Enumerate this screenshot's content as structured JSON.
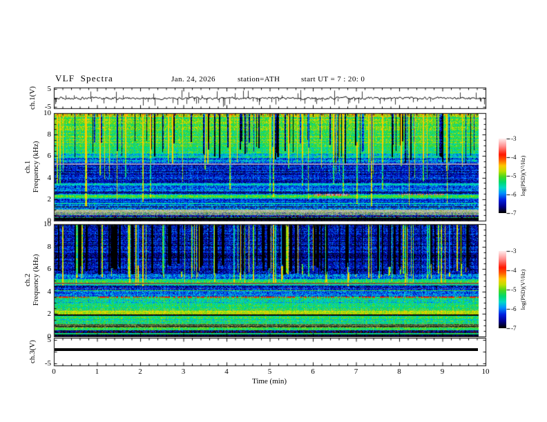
{
  "chart_data": {
    "type": "heatmap",
    "header": {
      "title": "VLF Spectra",
      "date": "Jan. 24, 2026",
      "station": "station=ATH",
      "start_ut": "start UT =  7 : 20: 0"
    },
    "time_axis": {
      "label": "Time (min)",
      "range": [
        0,
        10
      ],
      "tick_labels": [
        "0",
        "1",
        "2",
        "3",
        "4",
        "5",
        "6",
        "7",
        "8",
        "9",
        "10"
      ],
      "minor_per_major": 4,
      "data_end_min": 9.85
    },
    "colorbar": {
      "label": "log(PSD)(V²/Hz)",
      "tick_labels": [
        "-3",
        "-4",
        "-5",
        "-6",
        "-7"
      ],
      "value_range": [
        -7,
        -3
      ],
      "palette_stops": [
        [
          -7,
          "#000000"
        ],
        [
          -6.65,
          "#000090"
        ],
        [
          -6.3,
          "#0020e0"
        ],
        [
          -5.95,
          "#0090ff"
        ],
        [
          -5.65,
          "#00d8c8"
        ],
        [
          -5.35,
          "#00d870"
        ],
        [
          -5.05,
          "#48d820"
        ],
        [
          -4.75,
          "#c0e000"
        ],
        [
          -4.45,
          "#ffc800"
        ],
        [
          -4.15,
          "#ff6000"
        ],
        [
          -3.85,
          "#ff1800"
        ],
        [
          -3.4,
          "#ff9090"
        ],
        [
          -3.0,
          "#ffeaea"
        ]
      ]
    },
    "panels": [
      {
        "id": "ch1-waveform",
        "ylabel": "ch.1(V)",
        "yrange": [
          -5,
          5
        ],
        "ytick_labels": [
          "5",
          "-5"
        ],
        "signal": {
          "type": "noisy-line",
          "baseline": 0,
          "noise_amp": 0.7,
          "spike_count": 68,
          "spike_down_fraction": 0.6,
          "spike_amp_max": 5,
          "seed": 424242
        }
      },
      {
        "id": "ch1-spectrogram",
        "ylabel_lines": [
          "ch.1",
          "Frequency (kHz)"
        ],
        "yrange": [
          0,
          10
        ],
        "ytick_labels": [
          "10",
          "8",
          "6",
          "4",
          "2",
          "0"
        ],
        "seed": 12345,
        "bands": [
          {
            "f": [
              0,
              0.25
            ],
            "mean": -7,
            "spread": 0.15
          },
          {
            "f": [
              0.25,
              0.5
            ],
            "mean": -6.55,
            "spread": 0.5
          },
          {
            "f": [
              0.5,
              0.8
            ],
            "colors": [
              "#8a9478",
              "#b0b89c",
              "#98a880",
              "#6a7a5c",
              "#30c050",
              "#2a44aa",
              "#98a880"
            ]
          },
          {
            "f": [
              0.8,
              1.05
            ],
            "colors": [
              "#b4bcae",
              "#a2ac92",
              "#c2c8b8",
              "#8e9c7e",
              "#a8b840",
              "#b4bcae"
            ]
          },
          {
            "f": [
              1.05,
              1.55
            ],
            "mean": -6.1,
            "spread": 0.45
          },
          {
            "f": [
              1.55,
              1.7
            ],
            "mean": -5.6,
            "spread": 0.4
          },
          {
            "f": [
              1.7,
              2.05
            ],
            "mean": -6.2,
            "spread": 0.4
          },
          {
            "f": [
              2.05,
              2.45
            ],
            "mean": -5.25,
            "spread": 0.35
          },
          {
            "f": [
              2.45,
              2.8
            ],
            "mean": -6.3,
            "spread": 0.4
          },
          {
            "f": [
              2.8,
              3.3
            ],
            "mean": -6.1,
            "spread": 0.45
          },
          {
            "f": [
              3.3,
              3.5
            ],
            "mean": -5.5,
            "spread": 0.35
          },
          {
            "f": [
              3.5,
              5.2
            ],
            "mean": -6.45,
            "spread": 0.4
          },
          {
            "f": [
              5.2,
              5.35
            ],
            "colors": [
              "#9a93b8",
              "#b0a8c8",
              "#8888a8"
            ]
          },
          {
            "f": [
              5.35,
              5.9
            ],
            "mean": -6.05,
            "spread": 0.5
          },
          {
            "f": [
              5.9,
              6.3
            ],
            "mean": -5.6,
            "spread": 0.45
          },
          {
            "f": [
              6.3,
              7.2
            ],
            "mean": -5.3,
            "spread": 0.38
          },
          {
            "f": [
              7.2,
              9.7
            ],
            "mean": -5.12,
            "spread": 0.42
          },
          {
            "f": [
              9.7,
              10
            ],
            "mean": -4.8,
            "spread": 0.55
          }
        ],
        "lines": [
          {
            "f": 0.3,
            "color": "#28b048",
            "p": 0.7,
            "px": 1
          },
          {
            "f": 0.42,
            "color": "#8a2818",
            "p": 0.45,
            "px": 1
          },
          {
            "f": 1.32,
            "color": "#102060",
            "p": 0.8,
            "px": 2
          },
          {
            "f": 2.62,
            "color": "#0a1850",
            "p": 0.75,
            "px": 2
          },
          {
            "f": 3.9,
            "color": "#0a1440",
            "p": 0.6,
            "px": 1
          },
          {
            "f": 4.55,
            "color": "#0a1440",
            "p": 0.6,
            "px": 1
          },
          {
            "f": 2.42,
            "color": "#c0a0a0",
            "p": 0.85,
            "px": 3,
            "x": [
              6.1,
              6.95
            ],
            "dots": "#d04020"
          },
          {
            "f": 2.42,
            "color": "#b89890",
            "p": 0.7,
            "px": 2,
            "x": [
              8.1,
              9.2
            ],
            "dots": "#c05020"
          },
          {
            "f": 9.93,
            "color": "#d03010",
            "p": 0.22,
            "px": 1
          }
        ],
        "streaks": {
          "bright": {
            "count": 48,
            "delta": [
              0.8,
              1.7
            ],
            "f_lo": [
              1.3,
              5.5
            ],
            "f_hi": 10,
            "width": [
              1,
              2
            ]
          },
          "dark": {
            "count": 72,
            "delta": [
              -2.2,
              -1.0
            ],
            "f_lo": [
              5.3,
              7.6
            ],
            "f_hi": 10,
            "width": [
              1,
              2
            ]
          }
        }
      },
      {
        "id": "ch2-spectrogram",
        "ylabel_lines": [
          "ch.2",
          "Frequency (kHz)"
        ],
        "yrange": [
          0,
          10
        ],
        "ytick_labels": [
          "10",
          "8",
          "6",
          "4",
          "2",
          "0"
        ],
        "seed": 98765,
        "bands": [
          {
            "f": [
              0,
              0.2
            ],
            "mean": -7,
            "spread": 0.1
          },
          {
            "f": [
              0.2,
              0.33
            ],
            "mean": -5.2,
            "spread": 0.4
          },
          {
            "f": [
              0.33,
              0.55
            ],
            "mean": -6.75,
            "spread": 0.5
          },
          {
            "f": [
              0.55,
              0.78
            ],
            "mean": -5.15,
            "spread": 0.4
          },
          {
            "f": [
              0.78,
              1.1
            ],
            "colors": [
              "#4a5a3c",
              "#6a7a50",
              "#2a3a24",
              "#88a040",
              "#3a4a30"
            ]
          },
          {
            "f": [
              1.1,
              1.88
            ],
            "mean": -5.35,
            "spread": 0.42
          },
          {
            "f": [
              1.88,
              2.0
            ],
            "mean": -6.9,
            "spread": 0.3
          },
          {
            "f": [
              2.0,
              2.35
            ],
            "mean": -4.85,
            "spread": 0.3
          },
          {
            "f": [
              2.35,
              2.9
            ],
            "mean": -5.3,
            "spread": 0.4
          },
          {
            "f": [
              2.9,
              3.42
            ],
            "mean": -5.5,
            "spread": 0.45
          },
          {
            "f": [
              3.42,
              3.58
            ],
            "mean": -5.25,
            "spread": 0.3
          },
          {
            "f": [
              3.58,
              4.05
            ],
            "mean": -6.05,
            "spread": 0.45
          },
          {
            "f": [
              4.05,
              4.15
            ],
            "mean": -5.3,
            "spread": 0.3
          },
          {
            "f": [
              4.15,
              4.55
            ],
            "mean": -6.35,
            "spread": 0.5
          },
          {
            "f": [
              4.55,
              4.72
            ],
            "mean": -5.4,
            "spread": 0.35
          },
          {
            "f": [
              4.72,
              4.82
            ],
            "colors": [
              "#7a6858",
              "#9a5040",
              "#686058",
              "#585048"
            ]
          },
          {
            "f": [
              4.82,
              5.15
            ],
            "mean": -5.35,
            "spread": 0.4
          },
          {
            "f": [
              5.15,
              5.6
            ],
            "mean": -6.0,
            "spread": 0.5
          },
          {
            "f": [
              5.6,
              10
            ],
            "mean": -6.5,
            "spread": 0.45
          }
        ],
        "lines": [
          {
            "f": 3.5,
            "color": "#e02810",
            "p": 0.55,
            "px": 2
          },
          {
            "f": 4.35,
            "color": "#883068",
            "p": 0.28,
            "px": 1
          },
          {
            "f": 0.45,
            "color": "#a03010",
            "p": 0.35,
            "px": 1
          },
          {
            "f": 1.93,
            "color": "#000000",
            "p": 0.85,
            "px": 2
          },
          {
            "f": 0.9,
            "color": "#101808",
            "p": 0.7,
            "px": 1
          },
          {
            "f": 2.2,
            "color": "#d8e820",
            "p": 0.5,
            "px": 1
          },
          {
            "f": 9.95,
            "color": "#103050",
            "p": 0.4,
            "px": 1
          }
        ],
        "streaks": {
          "bright": {
            "count": 85,
            "delta": [
              0.9,
              2.1
            ],
            "f_lo": [
              4.5,
              5.9
            ],
            "f_hi": 10,
            "width": [
              1,
              2
            ]
          },
          "dark": {
            "count": 85,
            "delta": [
              -2.5,
              -1.2
            ],
            "f_lo": [
              5.5,
              6.6
            ],
            "f_hi": 10,
            "width": [
              1,
              4
            ]
          }
        }
      },
      {
        "id": "ch3-waveform",
        "ylabel": "ch.3(V)",
        "yrange": [
          -5,
          5
        ],
        "ytick_labels": [
          "5",
          "-5"
        ],
        "signal": {
          "type": "flat-line",
          "value": 0.5,
          "color": "#000000"
        }
      }
    ]
  }
}
